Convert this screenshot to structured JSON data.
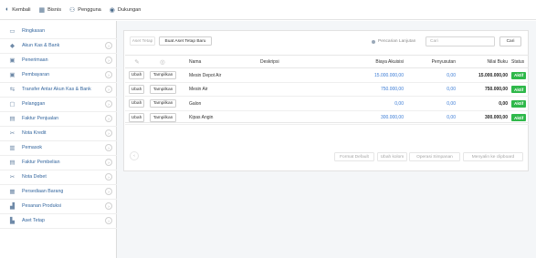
{
  "topbar": {
    "items": [
      {
        "label": "Kembali",
        "icon": "logo-icon"
      },
      {
        "label": "Bisnis",
        "icon": "building-icon"
      },
      {
        "label": "Pengguna",
        "icon": "users-icon"
      },
      {
        "label": "Dukungan",
        "icon": "help-icon"
      }
    ]
  },
  "sidebar": {
    "items": [
      {
        "label": "Ringkasan",
        "icon": "monitor-icon",
        "chevron": false
      },
      {
        "label": "Akun Kas & Bank",
        "icon": "cash-icon",
        "chevron": true
      },
      {
        "label": "Penerimaan",
        "icon": "receipt-icon",
        "chevron": true
      },
      {
        "label": "Pembayaran",
        "icon": "payment-icon",
        "chevron": true
      },
      {
        "label": "Transfer Antar Akun Kas & Bank",
        "icon": "transfer-icon",
        "chevron": true
      },
      {
        "label": "Pelanggan",
        "icon": "customer-icon",
        "chevron": true
      },
      {
        "label": "Faktur Penjualan",
        "icon": "invoice-icon",
        "chevron": true
      },
      {
        "label": "Nota Kredit",
        "icon": "scissors-icon",
        "chevron": true
      },
      {
        "label": "Pemasok",
        "icon": "supplier-icon",
        "chevron": true
      },
      {
        "label": "Faktur Pembelian",
        "icon": "invoice-icon",
        "chevron": true
      },
      {
        "label": "Nota Debet",
        "icon": "scissors-icon",
        "chevron": true
      },
      {
        "label": "Persediaan Barang",
        "icon": "inventory-icon",
        "chevron": true
      },
      {
        "label": "Pesanan Produksi",
        "icon": "production-icon",
        "chevron": true
      },
      {
        "label": "Aset Tetap",
        "icon": "asset-icon",
        "chevron": true
      }
    ]
  },
  "toolbar": {
    "asset_label": "Aset Tetap",
    "create_button": "Buat Aset Tetap Baru",
    "advanced_search": "Pencarian Lanjutan",
    "search_placeholder": "Cari",
    "search_button": "Cari"
  },
  "table": {
    "headers": {
      "name": "Nama",
      "description": "Deskripsi",
      "acquisition_cost": "Biaya Akuisisi",
      "depreciation": "Penyusutan",
      "book_value": "Nilai Buku",
      "status": "Status"
    },
    "edit_label": "Ubah",
    "view_label": "Tampilkan",
    "rows": [
      {
        "name": "Mesin Depot Air",
        "description": "",
        "acquisition_cost": "15.000.000,00",
        "depreciation": "0,00",
        "book_value": "15.000.000,00",
        "status": "Aktif"
      },
      {
        "name": "Mesin Air",
        "description": "",
        "acquisition_cost": "750.000,00",
        "depreciation": "0,00",
        "book_value": "750.000,00",
        "status": "Aktif"
      },
      {
        "name": "Galon",
        "description": "",
        "acquisition_cost": "0,00",
        "depreciation": "0,00",
        "book_value": "0,00",
        "status": "Aktif"
      },
      {
        "name": "Kipas Angin",
        "description": "",
        "acquisition_cost": "300.000,00",
        "depreciation": "0,00",
        "book_value": "300.000,00",
        "status": "Aktif"
      }
    ]
  },
  "footer": {
    "default_format": "Format Default",
    "change_columns": "Ubah kolom",
    "save_operation": "Operasi Simpanan",
    "copy_clipboard": "Menyalin ke clipboard"
  },
  "colors": {
    "link": "#3a7bd5",
    "status_active": "#2fb84a",
    "sidebar_text": "#34669e"
  }
}
